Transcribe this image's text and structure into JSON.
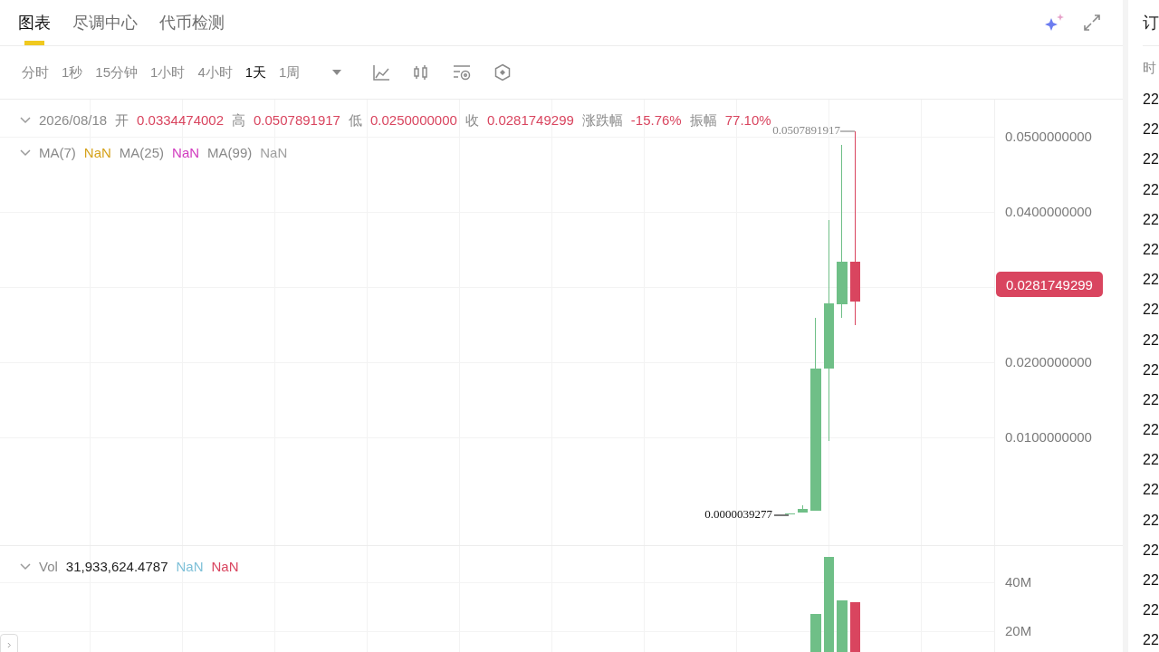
{
  "tabs": [
    {
      "label": "图表",
      "selected": true
    },
    {
      "label": "尽调中心",
      "selected": false
    },
    {
      "label": "代币检测",
      "selected": false
    }
  ],
  "intervals": [
    {
      "label": "分时",
      "selected": false
    },
    {
      "label": "1秒",
      "selected": false
    },
    {
      "label": "15分钟",
      "selected": false
    },
    {
      "label": "1小时",
      "selected": false
    },
    {
      "label": "4小时",
      "selected": false
    },
    {
      "label": "1天",
      "selected": true
    },
    {
      "label": "1周",
      "selected": false
    }
  ],
  "ohlc_legend": {
    "date": "2026/08/18",
    "fields": [
      {
        "label": "开",
        "value": "0.0334474002"
      },
      {
        "label": "高",
        "value": "0.0507891917"
      },
      {
        "label": "低",
        "value": "0.0250000000"
      },
      {
        "label": "收",
        "value": "0.0281749299"
      },
      {
        "label": "涨跌幅",
        "value": "-15.76%"
      },
      {
        "label": "振幅",
        "value": "77.10%"
      }
    ]
  },
  "ma_legend": [
    {
      "label": "MA(7)",
      "value": "NaN",
      "color": "#d5a21b"
    },
    {
      "label": "MA(25)",
      "value": "NaN",
      "color": "#d13bbf"
    },
    {
      "label": "MA(99)",
      "value": "NaN",
      "color": "#a0a0a0"
    }
  ],
  "price_axis": [
    "0.0500000000",
    "0.0400000000",
    "0.0200000000",
    "0.0100000000"
  ],
  "last_price": "0.0281749299",
  "high_marker": "0.0507891917",
  "low_marker": "0.0000039277",
  "volume": {
    "label": "Vol",
    "value": "31,933,624.4787",
    "extras": [
      {
        "value": "NaN",
        "color": "#7ec0d8"
      },
      {
        "value": "NaN",
        "color": "#d9455f"
      }
    ],
    "axis": [
      "40M",
      "20M"
    ]
  },
  "side_panel": {
    "title": "订",
    "header": "时",
    "rows": [
      "22",
      "22",
      "22",
      "22",
      "22",
      "22",
      "22",
      "22",
      "22",
      "22",
      "22",
      "22",
      "22",
      "22",
      "22",
      "22",
      "22",
      "22",
      "22"
    ]
  }
}
